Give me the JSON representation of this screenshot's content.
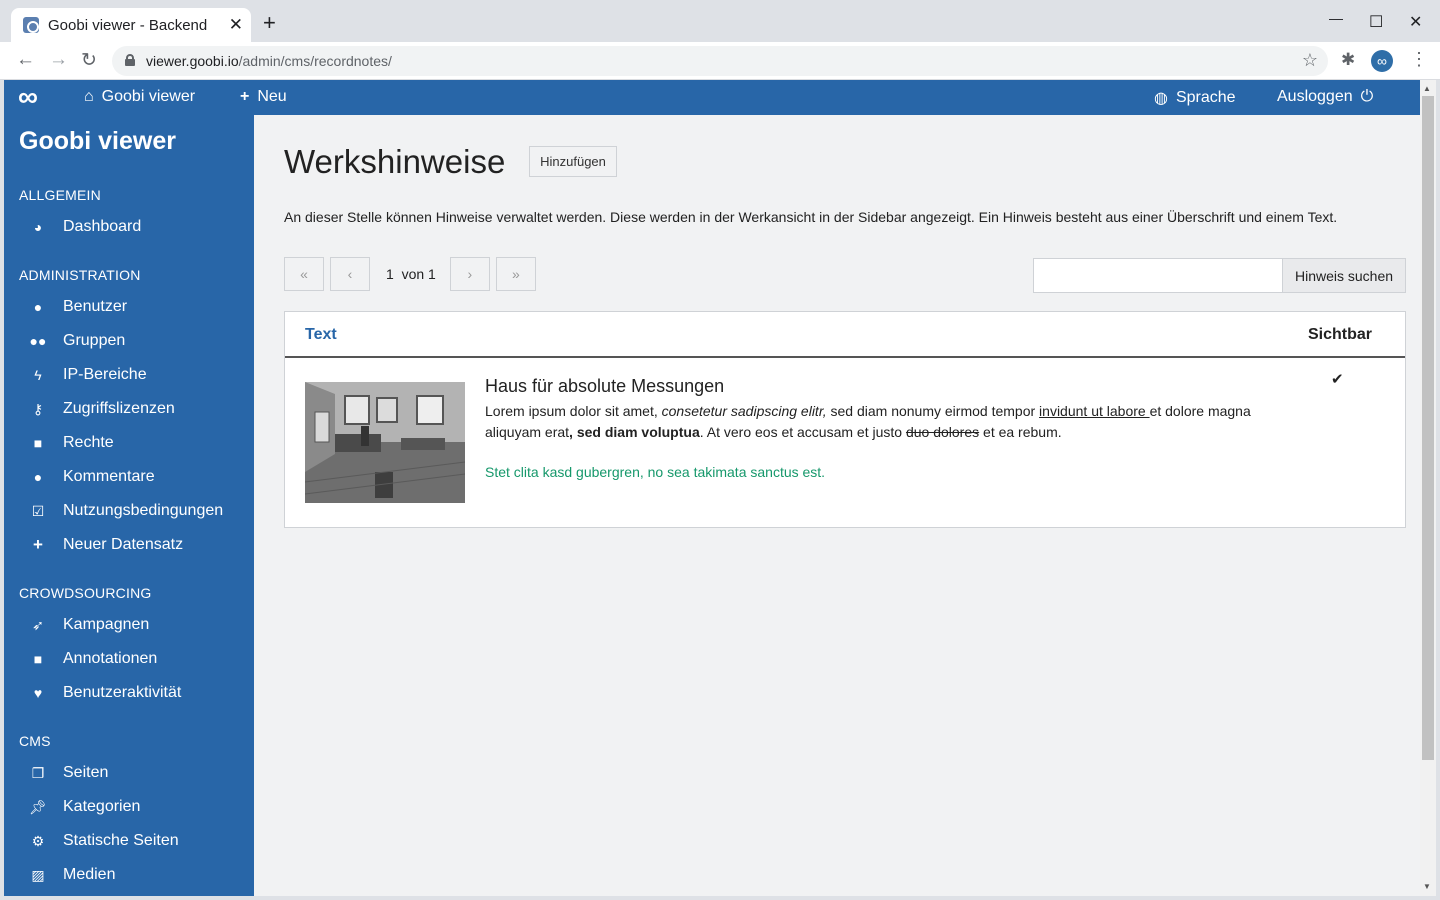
{
  "browser": {
    "tab_title": "Goobi viewer - Backend",
    "tab_close": "✕",
    "new_tab": "+",
    "minimize": "—",
    "maximize": "☐",
    "close": "✕",
    "url_domain": "viewer.goobi.io",
    "url_path": "/admin/cms/recordnotes/"
  },
  "topbar": {
    "logo": "∞",
    "home_label": "Goobi viewer",
    "new_label": "Neu",
    "language_label": "Sprache",
    "logout_label": "Ausloggen"
  },
  "sidebar": {
    "title": "Goobi viewer",
    "sections": [
      {
        "heading": "ALLGEMEIN",
        "items": [
          {
            "label": "Dashboard",
            "icon": "dashboard-icon"
          }
        ]
      },
      {
        "heading": "ADMINISTRATION",
        "items": [
          {
            "label": "Benutzer",
            "icon": "user-icon"
          },
          {
            "label": "Gruppen",
            "icon": "users-icon"
          },
          {
            "label": "IP-Bereiche",
            "icon": "bolt-icon"
          },
          {
            "label": "Zugriffslizenzen",
            "icon": "key-icon"
          },
          {
            "label": "Rechte",
            "icon": "lock-icon"
          },
          {
            "label": "Kommentare",
            "icon": "comments-icon"
          },
          {
            "label": "Nutzungsbedingungen",
            "icon": "checkbox-icon"
          },
          {
            "label": "Neuer Datensatz",
            "icon": "plus-icon"
          }
        ]
      },
      {
        "heading": "CROWDSOURCING",
        "items": [
          {
            "label": "Kampagnen",
            "icon": "rocket-icon"
          },
          {
            "label": "Annotationen",
            "icon": "sticky-note-icon"
          },
          {
            "label": "Benutzeraktivität",
            "icon": "heartbeat-icon"
          }
        ]
      },
      {
        "heading": "CMS",
        "items": [
          {
            "label": "Seiten",
            "icon": "pages-icon"
          },
          {
            "label": "Kategorien",
            "icon": "thumbtack-icon"
          },
          {
            "label": "Statische Seiten",
            "icon": "cogs-icon"
          },
          {
            "label": "Medien",
            "icon": "image-icon"
          }
        ]
      }
    ]
  },
  "main": {
    "title": "Werkshinweise",
    "add_button": "Hinzufügen",
    "intro": "An dieser Stelle können Hinweise verwaltet werden. Diese werden in der Werkansicht in der Sidebar angezeigt. Ein Hinweis besteht aus einer Überschrift und einem Text.",
    "pager": {
      "current": "1",
      "of": "von",
      "total": "1"
    },
    "search": {
      "placeholder": "",
      "button": "Hinweis suchen"
    },
    "table": {
      "col_text": "Text",
      "col_visible": "Sichtbar",
      "rows": [
        {
          "title": "Haus für absolute Messungen",
          "body_1": "Lorem ipsum dolor sit amet, ",
          "body_italic": "consetetur sadipscing elitr,",
          "body_2": " sed diam nonumy eirmod tempor ",
          "body_underline": "invidunt ut labore ",
          "body_3": "et dolore magna aliquyam erat",
          "body_bold": ", sed diam voluptua",
          "body_4": ". At vero eos et accusam et justo ",
          "body_strike": "duo dolores",
          "body_5": " et ea rebum.",
          "link_text": "Stet clita kasd gubergren, no sea takimata sanctus est.",
          "visible": true
        }
      ]
    }
  },
  "colors": {
    "primary": "#2866a8",
    "link_green": "#16986b",
    "background": "#f1f2f3"
  }
}
